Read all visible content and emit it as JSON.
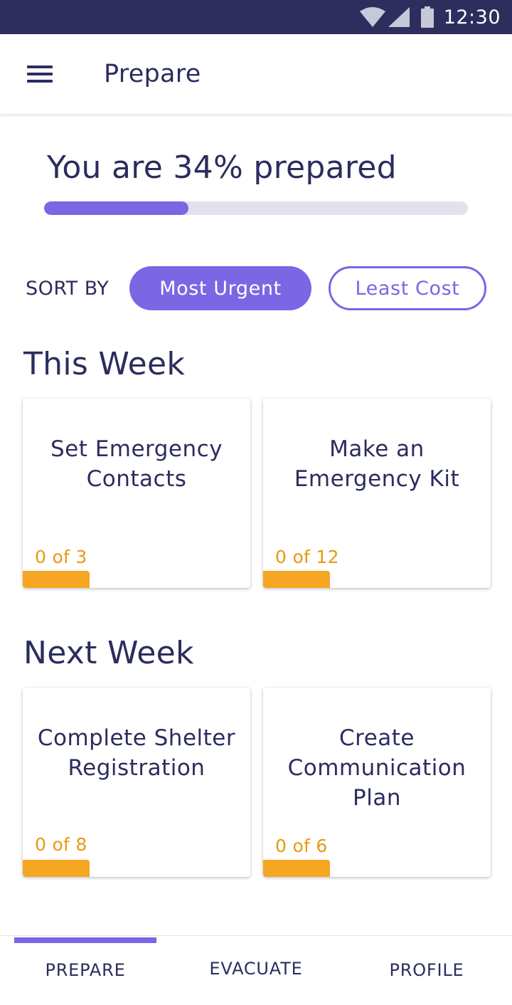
{
  "status_bar": {
    "time": "12:30",
    "icons": [
      "wifi-icon",
      "cell-signal-icon",
      "battery-icon"
    ],
    "background": "#2e2e5e"
  },
  "app_bar": {
    "title": "Prepare",
    "menu_icon": "hamburger-menu-icon"
  },
  "progress": {
    "title": "You are 34% prepared",
    "value": 0.34,
    "fill_color": "#7b66e4",
    "track_color": "#e1e2ef"
  },
  "sort": {
    "label": "SORT BY",
    "options": [
      {
        "label": "Most Urgent",
        "selected": true
      },
      {
        "label": "Least Cost",
        "selected": false
      }
    ]
  },
  "sections": [
    {
      "title": "This Week",
      "cards": [
        {
          "title": "Set Emergency Contacts",
          "count": "0 of 3"
        },
        {
          "title": "Make an Emergency Kit",
          "count": "0 of 12"
        }
      ]
    },
    {
      "title": "Next Week",
      "cards": [
        {
          "title": "Complete Shelter Registration",
          "count": "0 of 8"
        },
        {
          "title": "Create Communication Plan",
          "count": "0 of 6"
        }
      ]
    }
  ],
  "bottom_nav": {
    "items": [
      {
        "label": "PREPARE",
        "active": true
      },
      {
        "label": "EVACUATE",
        "active": false
      },
      {
        "label": "PROFILE",
        "active": false
      }
    ]
  },
  "colors": {
    "accent": "#7b66e4",
    "text": "#2b2d5e",
    "count": "#e89a10",
    "count_bar": "#f5a623"
  }
}
